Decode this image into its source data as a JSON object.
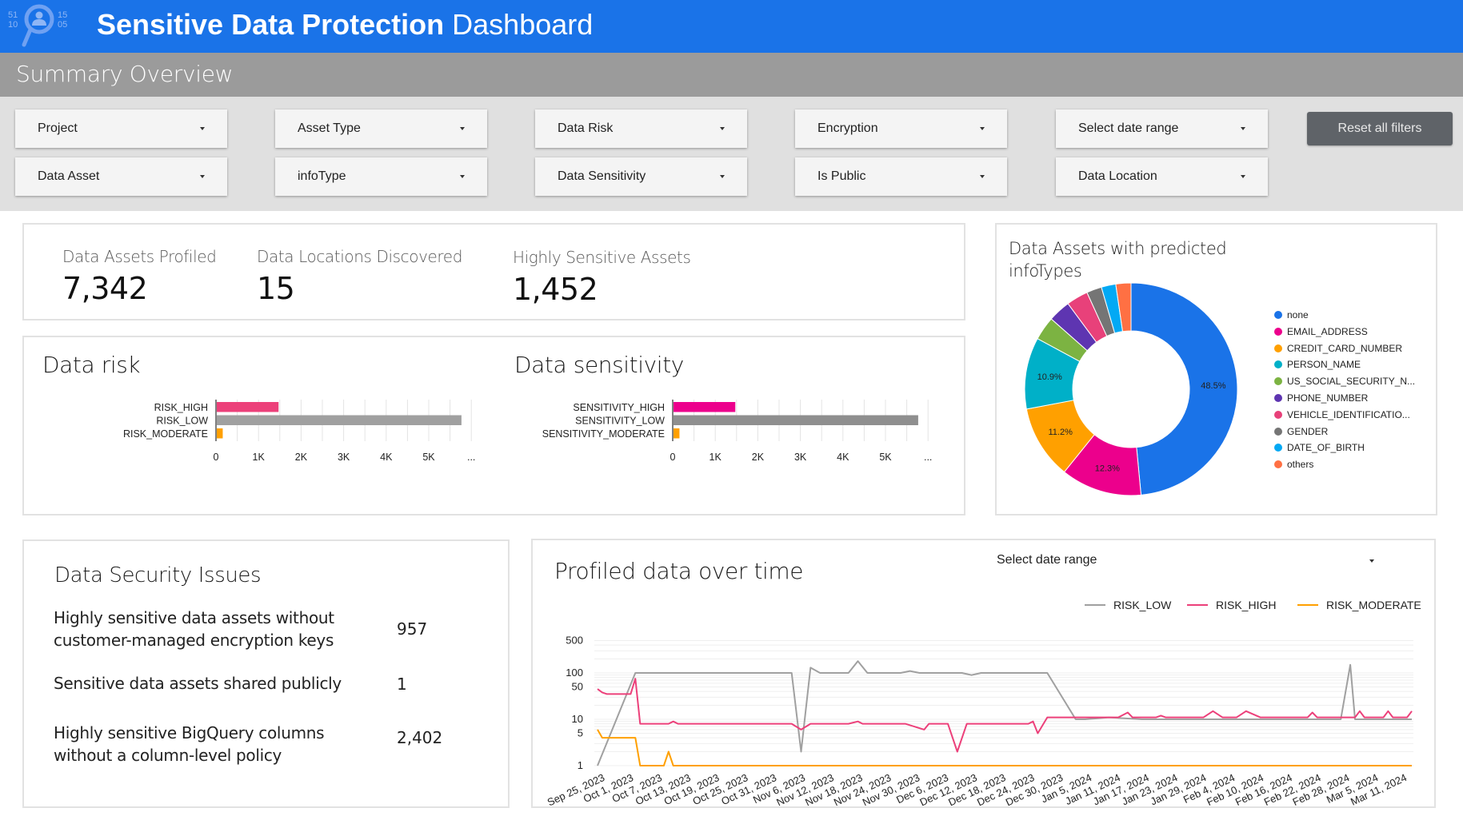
{
  "header": {
    "title_bold": "Sensitive Data Protection",
    "title_light": "Dashboard",
    "logo_digits": [
      "51",
      "10",
      "15",
      "05"
    ]
  },
  "subheader": {
    "title": "Summary Overview"
  },
  "filters": {
    "row1": [
      "Project",
      "Asset Type",
      "Data Risk",
      "Encryption",
      "Select date range"
    ],
    "row2": [
      "Data Asset",
      "infoType",
      "Data Sensitivity",
      "Is Public",
      "Data Location"
    ],
    "reset_label": "Reset all filters"
  },
  "kpis": [
    {
      "label": "Data Assets Profiled",
      "value": "7,342"
    },
    {
      "label": "Data Locations Discovered",
      "value": "15"
    },
    {
      "label": "Highly Sensitive Assets",
      "value": "1,452"
    }
  ],
  "security": {
    "title": "Data Security Issues",
    "items": [
      {
        "line1": "Highly sensitive data assets without",
        "line2": "customer-managed encryption keys",
        "value": "957"
      },
      {
        "line1": "Sensitive data assets shared publicly",
        "line2": "",
        "value": "1"
      },
      {
        "line1": "Highly sensitive BigQuery columns",
        "line2": "without a column-level policy",
        "value": "2,402"
      }
    ]
  },
  "profiled": {
    "title": "Profiled data over time",
    "date_range_label": "Select date range"
  },
  "colors": {
    "brand_blue": "#1a73e8",
    "risk_high": "#ec407a",
    "risk_low": "#a0a0a0",
    "risk_moderate": "#ffa000",
    "sensitivity_high": "#ec008c",
    "sensitivity_low": "#8f8f8f"
  },
  "chart_data": [
    {
      "id": "data-risk",
      "type": "bar",
      "orientation": "horizontal",
      "title": "Data risk",
      "categories": [
        "RISK_HIGH",
        "RISK_LOW",
        "RISK_MODERATE"
      ],
      "values": [
        1452,
        5750,
        140
      ],
      "colors": [
        "#ec407a",
        "#a0a0a0",
        "#ffa000"
      ],
      "xticks": [
        "0",
        "1K",
        "2K",
        "3K",
        "4K",
        "5K",
        "..."
      ],
      "xlim": [
        0,
        6000
      ],
      "grid": true
    },
    {
      "id": "data-sensitivity",
      "type": "bar",
      "orientation": "horizontal",
      "title": "Data sensitivity",
      "categories": [
        "SENSITIVITY_HIGH",
        "SENSITIVITY_LOW",
        "SENSITIVITY_MODERATE"
      ],
      "values": [
        1452,
        5750,
        140
      ],
      "colors": [
        "#ec008c",
        "#8f8f8f",
        "#ffa000"
      ],
      "xticks": [
        "0",
        "1K",
        "2K",
        "3K",
        "4K",
        "5K",
        "..."
      ],
      "xlim": [
        0,
        6000
      ],
      "grid": true
    },
    {
      "id": "infotypes",
      "type": "pie",
      "donut": true,
      "title": "Data Assets with predicted infoTypes",
      "legend_position": "right",
      "slices": [
        {
          "label": "none",
          "value": 48.5,
          "color": "#1a73e8",
          "show_label": true
        },
        {
          "label": "EMAIL_ADDRESS",
          "value": 12.3,
          "color": "#ec008c",
          "show_label": true
        },
        {
          "label": "CREDIT_CARD_NUMBER",
          "value": 11.2,
          "color": "#ffa000",
          "show_label": true
        },
        {
          "label": "PERSON_NAME",
          "value": 10.9,
          "color": "#00b0c8",
          "show_label": true
        },
        {
          "label": "US_SOCIAL_SECURITY_N...",
          "value": 3.6,
          "color": "#7cb342",
          "show_label": false
        },
        {
          "label": "PHONE_NUMBER",
          "value": 3.4,
          "color": "#5e35b1",
          "show_label": false
        },
        {
          "label": "VEHICLE_IDENTIFICATIO...",
          "value": 3.3,
          "color": "#e8417a",
          "show_label": false
        },
        {
          "label": "GENDER",
          "value": 2.3,
          "color": "#757575",
          "show_label": false
        },
        {
          "label": "DATE_OF_BIRTH",
          "value": 2.2,
          "color": "#03a9f4",
          "show_label": false
        },
        {
          "label": "others",
          "value": 2.3,
          "color": "#ff7043",
          "show_label": false
        }
      ]
    },
    {
      "id": "profiled-over-time",
      "type": "line",
      "title": "Profiled data over time",
      "yscale": "log",
      "ylim": [
        1,
        500
      ],
      "yticks": [
        1,
        5,
        10,
        50,
        100,
        500
      ],
      "legend_position": "top-right",
      "x_labels": [
        "Sep 25, 2023",
        "Oct 1, 2023",
        "Oct 7, 2023",
        "Oct 13, 2023",
        "Oct 19, 2023",
        "Oct 25, 2023",
        "Oct 31, 2023",
        "Nov 6, 2023",
        "Nov 12, 2023",
        "Nov 18, 2023",
        "Nov 24, 2023",
        "Nov 30, 2023",
        "Dec 6, 2023",
        "Dec 12, 2023",
        "Dec 18, 2023",
        "Dec 24, 2023",
        "Dec 30, 2023",
        "Jan 5, 2024",
        "Jan 11, 2024",
        "Jan 17, 2024",
        "Jan 23, 2024",
        "Jan 29, 2024",
        "Feb 4, 2024",
        "Feb 10, 2024",
        "Feb 16, 2024",
        "Feb 22, 2024",
        "Feb 28, 2024",
        "Mar 5, 2024",
        "Mar 11, 2024"
      ],
      "x_range_days": [
        0,
        172
      ],
      "series": [
        {
          "name": "RISK_LOW",
          "color": "#a0a0a0",
          "points": [
            [
              0,
              1
            ],
            [
              8,
              100
            ],
            [
              15,
              100
            ],
            [
              22,
              100
            ],
            [
              29,
              100
            ],
            [
              36,
              100
            ],
            [
              41,
              100
            ],
            [
              43,
              2
            ],
            [
              45,
              130
            ],
            [
              47,
              100
            ],
            [
              53,
              100
            ],
            [
              55,
              180
            ],
            [
              57,
              100
            ],
            [
              64,
              100
            ],
            [
              66,
              110
            ],
            [
              68,
              100
            ],
            [
              77,
              100
            ],
            [
              79,
              90
            ],
            [
              81,
              100
            ],
            [
              95,
              100
            ],
            [
              101,
              10
            ],
            [
              103,
              10
            ],
            [
              108,
              11
            ],
            [
              115,
              10
            ],
            [
              125,
              10
            ],
            [
              135,
              10
            ],
            [
              145,
              10
            ],
            [
              155,
              10
            ],
            [
              157,
              10
            ],
            [
              159,
              150
            ],
            [
              160,
              10
            ],
            [
              165,
              10
            ],
            [
              172,
              10
            ]
          ]
        },
        {
          "name": "RISK_HIGH",
          "color": "#ec407a",
          "points": [
            [
              0,
              45
            ],
            [
              1,
              38
            ],
            [
              2,
              35
            ],
            [
              7,
              35
            ],
            [
              8,
              75
            ],
            [
              9,
              8
            ],
            [
              15,
              8
            ],
            [
              16,
              9
            ],
            [
              17,
              8
            ],
            [
              41,
              8
            ],
            [
              43,
              6
            ],
            [
              45,
              8
            ],
            [
              53,
              8
            ],
            [
              55,
              9
            ],
            [
              56,
              8
            ],
            [
              65,
              8
            ],
            [
              69,
              6
            ],
            [
              70,
              8
            ],
            [
              74,
              8
            ],
            [
              76,
              2
            ],
            [
              78,
              8
            ],
            [
              91,
              8
            ],
            [
              92,
              9
            ],
            [
              93,
              5
            ],
            [
              95,
              11
            ],
            [
              100,
              11
            ],
            [
              110,
              11
            ],
            [
              112,
              14
            ],
            [
              113,
              11
            ],
            [
              118,
              11
            ],
            [
              119,
              12
            ],
            [
              120,
              11
            ],
            [
              128,
              11
            ],
            [
              130,
              15
            ],
            [
              132,
              11
            ],
            [
              135,
              11
            ],
            [
              137,
              15
            ],
            [
              140,
              11
            ],
            [
              150,
              11
            ],
            [
              151,
              14
            ],
            [
              152,
              11
            ],
            [
              160,
              11
            ],
            [
              161,
              15
            ],
            [
              162,
              11
            ],
            [
              166,
              11
            ],
            [
              167,
              15
            ],
            [
              168,
              11
            ],
            [
              171,
              11
            ],
            [
              172,
              15
            ]
          ]
        },
        {
          "name": "RISK_MODERATE",
          "color": "#ffa000",
          "points": [
            [
              0,
              6
            ],
            [
              1,
              4
            ],
            [
              8,
              4
            ],
            [
              9,
              1
            ],
            [
              14,
              1
            ],
            [
              15,
              2
            ],
            [
              16,
              1
            ],
            [
              172,
              1
            ]
          ]
        }
      ]
    }
  ]
}
